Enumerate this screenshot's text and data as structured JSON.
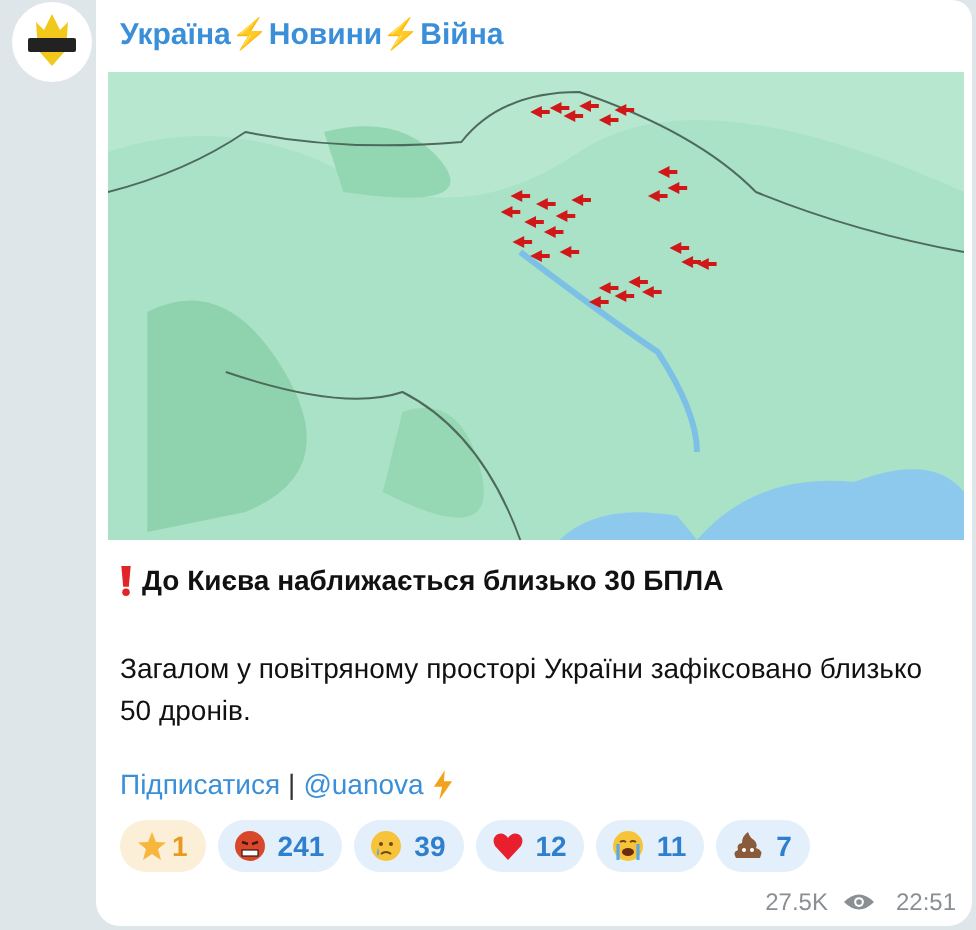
{
  "channel": {
    "title": "Україна⚡Новини⚡Війна"
  },
  "message": {
    "headline": "До Києва наближається близько 30 БПЛА",
    "body": "Загалом у повітряному просторі України зафіксовано близько 50 дронів.",
    "links": [
      {
        "text": "Підписатися",
        "kind": "link"
      },
      {
        "text": "|",
        "kind": "separator"
      },
      {
        "text": "@uanova",
        "kind": "link"
      }
    ],
    "reactions": [
      {
        "kind": "star",
        "count": "1",
        "paid": true
      },
      {
        "kind": "angry",
        "count": "241",
        "paid": false
      },
      {
        "kind": "tear",
        "count": "39",
        "paid": false
      },
      {
        "kind": "heart",
        "count": "12",
        "paid": false
      },
      {
        "kind": "sob",
        "count": "11",
        "paid": false
      },
      {
        "kind": "poop",
        "count": "7",
        "paid": false
      }
    ],
    "views": "27.5K",
    "time": "22:51"
  }
}
